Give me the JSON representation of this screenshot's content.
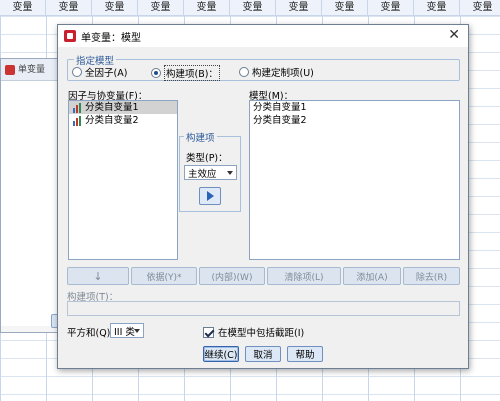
{
  "sheet": {
    "columns": [
      "变量",
      "变量",
      "变量",
      "变量",
      "变量",
      "变量",
      "变量",
      "变量",
      "变量",
      "变量",
      "变量"
    ]
  },
  "bg_dialog": {
    "title": "单变量"
  },
  "dialog": {
    "title": "单变量：模型",
    "close_symbol": "✕"
  },
  "specify_model": {
    "legend": "指定模型",
    "options": [
      {
        "label": "全因子(A)",
        "selected": false
      },
      {
        "label": "构建项(B)：",
        "selected": true
      },
      {
        "label": "构建定制项(U)",
        "selected": false
      }
    ]
  },
  "factors": {
    "label": "因子与协变量(F)：",
    "items": [
      {
        "label": "分类自变量1",
        "selected": true,
        "icon": "nominal-var-icon"
      },
      {
        "label": "分类自变量2",
        "selected": false,
        "icon": "nominal-var-icon"
      }
    ]
  },
  "build_term": {
    "legend": "构建项",
    "type_label": "类型(P)：",
    "type_value": "主效应",
    "move_icon": "arrow-right-icon"
  },
  "model": {
    "label": "模型(M)：",
    "items": [
      "分类自变量1",
      "分类自变量2"
    ]
  },
  "build_buttons": {
    "down": "↓",
    "by": "依据(Y)*",
    "within": "(内部)(W)",
    "clear": "清除项(L)",
    "add": "添加(A)",
    "remove": "除去(R)"
  },
  "build_term_label": "构建项(T)：",
  "sum_of_squares": {
    "label": "平方和(Q)",
    "value": "III 类"
  },
  "include_intercept": {
    "label": "在模型中包括截距(I)",
    "checked": true
  },
  "actions": {
    "continue": "继续(C)",
    "cancel": "取消",
    "help": "帮助"
  }
}
